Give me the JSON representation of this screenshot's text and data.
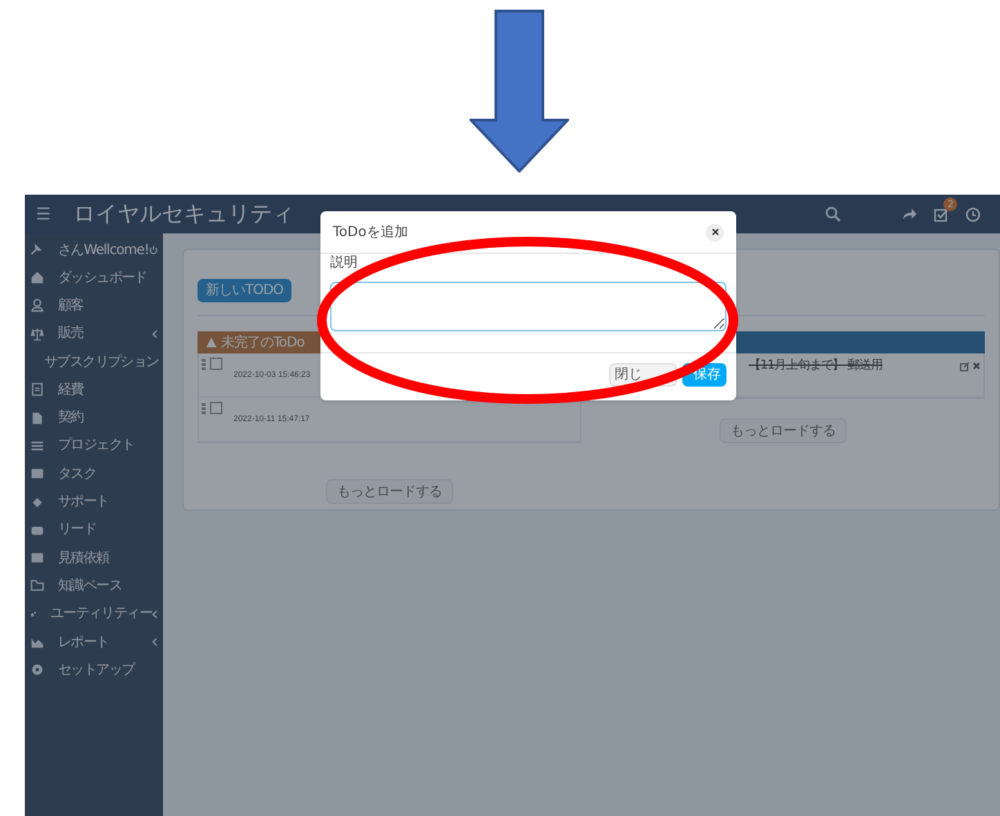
{
  "app": {
    "menu_glyph": "☰",
    "title": "ロイヤルセキュリティ",
    "notification_count": "2"
  },
  "sidebar": {
    "user": "さんWellcome!",
    "items": [
      {
        "label": "ダッシュボード",
        "submenu": false
      },
      {
        "label": "顧客",
        "submenu": false
      },
      {
        "label": "販売",
        "submenu": true
      },
      {
        "label": "サブスクリプション",
        "submenu": false
      },
      {
        "label": "経費",
        "submenu": false
      },
      {
        "label": "契約",
        "submenu": false
      },
      {
        "label": "プロジェクト",
        "submenu": false
      },
      {
        "label": "タスク",
        "submenu": false
      },
      {
        "label": "サポート",
        "submenu": false
      },
      {
        "label": "リード",
        "submenu": false
      },
      {
        "label": "見積依頼",
        "submenu": false
      },
      {
        "label": "知識ベース",
        "submenu": false
      },
      {
        "label": "ユーティリティー",
        "submenu": true
      },
      {
        "label": "レポート",
        "submenu": true
      },
      {
        "label": "セットアップ",
        "submenu": false
      }
    ]
  },
  "main": {
    "new_button": "新しいTODO",
    "columns": [
      {
        "header": "未完了のToDo",
        "kind": "pending",
        "items": [
          {
            "date": "2022-10-03 15:46:23",
            "done": false
          },
          {
            "date": "2022-10-11 15:47:17",
            "done": false
          }
        ],
        "load_more": "もっとロードする"
      },
      {
        "kind": "finished",
        "items": [
          {
            "text": "【11月上旬まで】-郵送用",
            "done": true
          }
        ],
        "load_more": "もっとロードする"
      }
    ]
  },
  "modal": {
    "title": "ToDoを追加",
    "field_label": "説明",
    "buttons": [
      {
        "label": "閉じ",
        "kind": "secondary"
      },
      {
        "label": "保存",
        "kind": "primary"
      }
    ]
  }
}
